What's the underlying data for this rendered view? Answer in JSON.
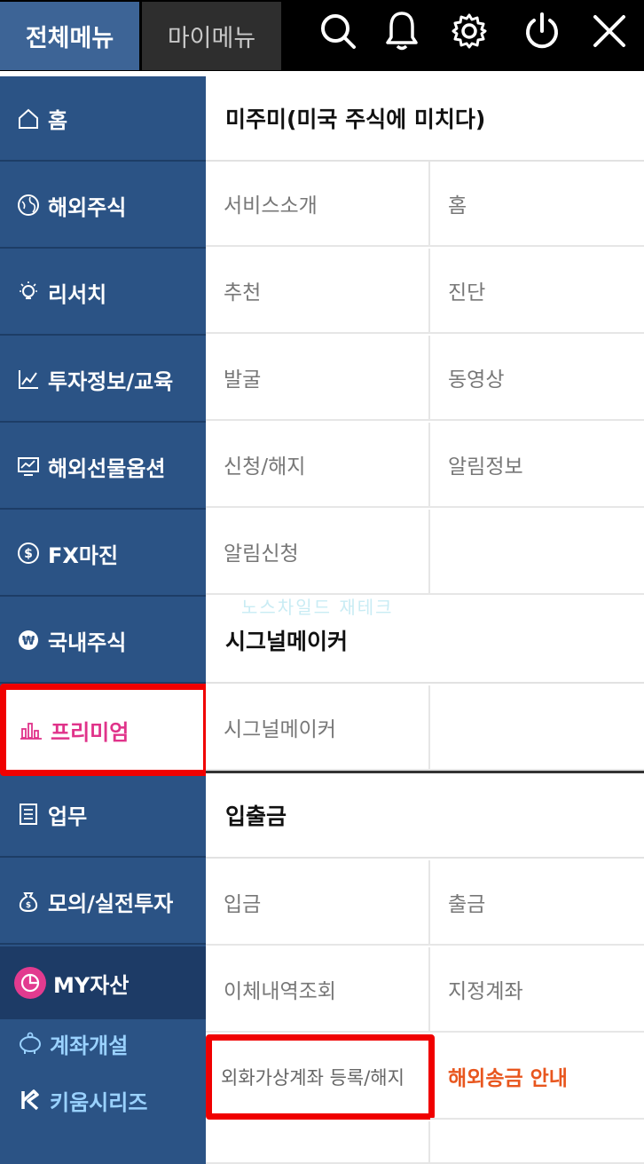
{
  "tabs": {
    "all": "전체메뉴",
    "my": "마이메뉴"
  },
  "top_icons": [
    "search-icon",
    "bell-icon",
    "gear-icon",
    "power-icon",
    "close-icon"
  ],
  "sidebar": {
    "items": [
      {
        "label": "홈",
        "icon": "home-icon"
      },
      {
        "label": "해외주식",
        "icon": "globe-icon"
      },
      {
        "label": "리서치",
        "icon": "lightbulb-icon"
      },
      {
        "label": "투자정보/교육",
        "icon": "line-chart-icon"
      },
      {
        "label": "해외선물옵션",
        "icon": "monitor-chart-icon"
      },
      {
        "label": "FX마진",
        "icon": "dollar-icon"
      },
      {
        "label": "국내주식",
        "icon": "won-icon"
      },
      {
        "label": "프리미엄",
        "icon": "bar-chart-icon"
      },
      {
        "label": "업무",
        "icon": "checklist-icon"
      },
      {
        "label": "모의/실전투자",
        "icon": "money-bag-icon"
      }
    ],
    "my_asset": "MY자산",
    "links": [
      {
        "label": "계좌개설",
        "icon": "piggy-bank-icon"
      },
      {
        "label": "키움시리즈",
        "icon": "kiwoom-logo-icon"
      }
    ]
  },
  "content": {
    "sections": {
      "mijumi": "미주미(미국 주식에 미치다)",
      "signal": "시그널메이커",
      "deposit": "입출금"
    },
    "mijumi_items": [
      "서비스소개",
      "홈",
      "추천",
      "진단",
      "발굴",
      "동영상",
      "신청/해지",
      "알림정보",
      "알림신청"
    ],
    "signal_items": [
      "시그널메이커"
    ],
    "deposit_items": [
      "입금",
      "출금",
      "이체내역조회",
      "지정계좌",
      "외화가상계좌 등록/해지",
      "해외송금 안내"
    ],
    "watermark": "노스차일드 재테크"
  },
  "colors": {
    "topbar": "#000000",
    "tab_active": "#3d6496",
    "sidebar": "#2b5385",
    "highlight_border": "#f00000",
    "premium_text": "#e0338a",
    "orange_link": "#e8561e"
  }
}
